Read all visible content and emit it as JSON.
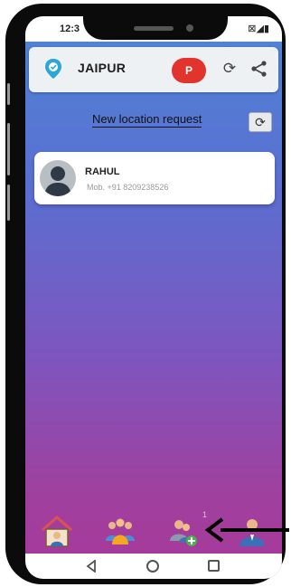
{
  "status_bar": {
    "time": "12:3",
    "icons": "⊠◢▮"
  },
  "header": {
    "city": "JAIPUR",
    "avatar_letter": "P",
    "refresh_icon": "⟳"
  },
  "location_request": {
    "label": "New location request",
    "refresh_icon": "⟳"
  },
  "contacts": [
    {
      "name": "RAHUL",
      "phone": "Mob. +91 8209238526"
    }
  ],
  "bottom_nav": {
    "items": [
      "home-icon",
      "group-icon",
      "add-member-icon",
      "person-icon"
    ],
    "add_count": "1"
  },
  "colors": {
    "gradient_top": "#4e86d6",
    "gradient_bottom": "#a8389a",
    "avatar_badge": "#e0342c"
  }
}
